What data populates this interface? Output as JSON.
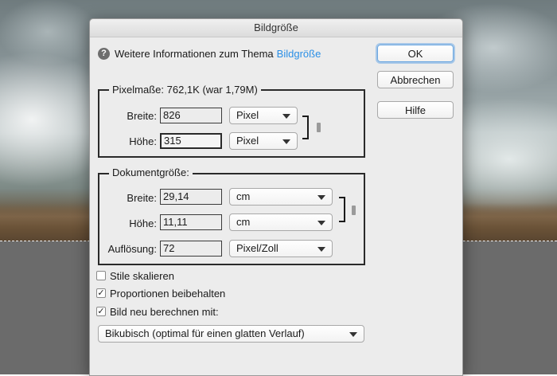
{
  "dialog": {
    "title": "Bildgröße",
    "info_text": "Weitere Informationen zum Thema",
    "info_link": "Bildgröße",
    "buttons": {
      "ok": "OK",
      "cancel": "Abbrechen",
      "help": "Hilfe"
    }
  },
  "pixel_dims": {
    "title": "Pixelmaße: 762,1K (war 1,79M)",
    "width_label": "Breite:",
    "width_value": "826",
    "width_unit": "Pixel",
    "height_label": "Höhe:",
    "height_value": "315",
    "height_unit": "Pixel"
  },
  "document_size": {
    "title": "Dokumentgröße:",
    "width_label": "Breite:",
    "width_value": "29,14",
    "width_unit": "cm",
    "height_label": "Höhe:",
    "height_value": "11,11",
    "height_unit": "cm",
    "resolution_label": "Auflösung:",
    "resolution_value": "72",
    "resolution_unit": "Pixel/Zoll"
  },
  "options": {
    "scale_styles": {
      "label": "Stile skalieren",
      "checked": false
    },
    "constrain_proportions": {
      "label": "Proportionen beibehalten",
      "checked": true
    },
    "resample": {
      "label": "Bild neu berechnen mit:",
      "checked": true
    },
    "resample_method": "Bikubisch (optimal für einen glatten Verlauf)"
  },
  "colors": {
    "accent": "#2a8fe6",
    "dialog_bg": "#ececec",
    "canvas_gray": "#6b6b6b"
  }
}
